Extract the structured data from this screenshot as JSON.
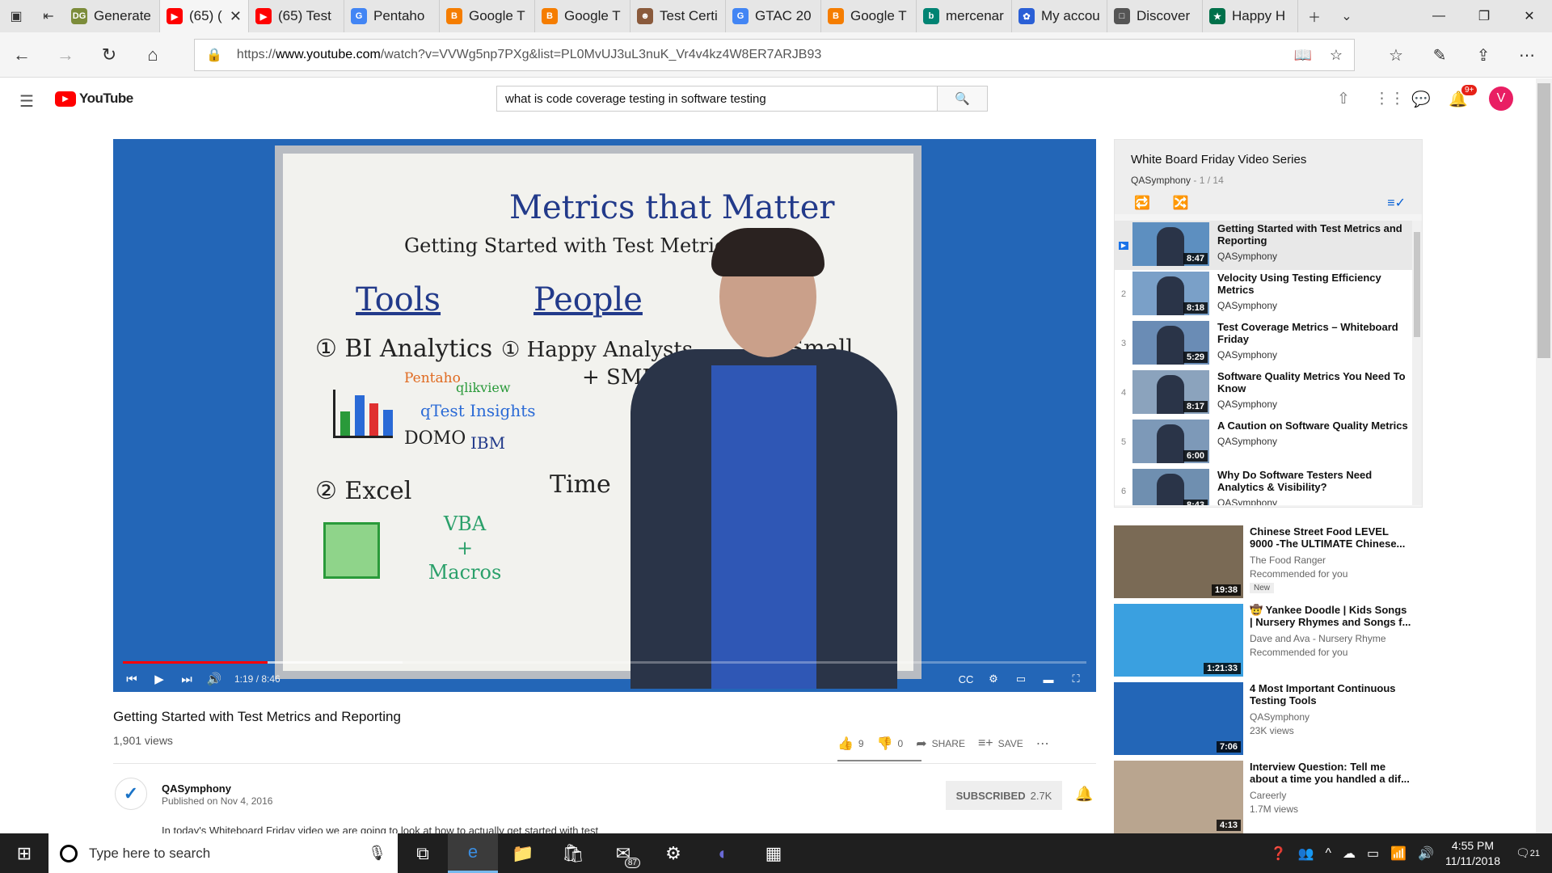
{
  "tabs": [
    {
      "label": "Generate",
      "fav": "DG",
      "color": "#7c8c3a"
    },
    {
      "label": "(65) (",
      "fav": "▶",
      "color": "#ff0000"
    },
    {
      "label": "(65) Test",
      "fav": "▶",
      "color": "#ff0000"
    },
    {
      "label": "Pentaho",
      "fav": "G",
      "color": "#4285f4"
    },
    {
      "label": "Google T",
      "fav": "B",
      "color": "#f57d00"
    },
    {
      "label": "Google T",
      "fav": "B",
      "color": "#f57d00"
    },
    {
      "label": "Test Certi",
      "fav": "☻",
      "color": "#8a5a3c"
    },
    {
      "label": "GTAC 20",
      "fav": "G",
      "color": "#4285f4"
    },
    {
      "label": "Google T",
      "fav": "B",
      "color": "#f57d00"
    },
    {
      "label": "mercenar",
      "fav": "b",
      "color": "#008373"
    },
    {
      "label": "My accou",
      "fav": "✿",
      "color": "#2a5fd6"
    },
    {
      "label": "Discover",
      "fav": "□",
      "color": "#555555"
    },
    {
      "label": "Happy H",
      "fav": "★",
      "color": "#00704a"
    }
  ],
  "address": {
    "prefix": "https://",
    "host": "www.youtube.com",
    "path": "/watch?v=VVWg5np7PXg&list=PL0MvUJ3uL3nuK_Vr4v4kz4W8ER7ARJB93"
  },
  "yt": {
    "logo": "YouTube",
    "search": "what is code coverage testing in software testing",
    "notif_count": "9+",
    "avatar": "V"
  },
  "video": {
    "board_title": "Metrics that Matter",
    "board_sub": "Getting Started with Test Metrics a",
    "board_tools": "Tools",
    "board_people": "People",
    "board_bi": "① BI Analytics",
    "board_excel": "② Excel",
    "board_happy": "① Happy Analysts",
    "board_smes": "+ SMEs",
    "board_small": "Small",
    "board_time": "Time",
    "board_vba": "VBA",
    "board_plus": "+",
    "board_macros": "Macros",
    "board_pentaho": "Pentaho",
    "board_qlik": "qlikview",
    "board_qtest": "qTest Insights",
    "board_domo": "DOMO",
    "board_ibm": "IBM",
    "time": "1:19 / 8:46",
    "progress_fraction": 0.15,
    "buffered_fraction": 0.29,
    "title": "Getting Started with Test Metrics and Reporting",
    "views": "1,901 views",
    "likes": "9",
    "dislikes": "0",
    "share": "SHARE",
    "save": "SAVE"
  },
  "channel": {
    "name": "QASymphony",
    "published": "Published on Nov 4, 2016",
    "subscribe": "SUBSCRIBED",
    "subs": "2.7K",
    "desc": "In today's Whiteboard Friday video we are going to look at how to actually get started with test"
  },
  "playlist": {
    "title": "White Board Friday Video Series",
    "channel": "QASymphony",
    "count": "1 / 14",
    "items": [
      {
        "index": "▶",
        "title": "Getting Started with Test Metrics and Reporting",
        "channel": "QASymphony",
        "duration": "8:47"
      },
      {
        "index": "2",
        "title": "Velocity Using Testing Efficiency Metrics",
        "channel": "QASymphony",
        "duration": "8:18"
      },
      {
        "index": "3",
        "title": "Test Coverage Metrics – Whiteboard Friday",
        "channel": "QASymphony",
        "duration": "5:29"
      },
      {
        "index": "4",
        "title": "Software Quality Metrics You Need To Know",
        "channel": "QASymphony",
        "duration": "8:17"
      },
      {
        "index": "5",
        "title": "A Caution on Software Quality Metrics",
        "channel": "QASymphony",
        "duration": "6:00"
      },
      {
        "index": "6",
        "title": "Why Do Software Testers Need Analytics & Visibility?",
        "channel": "QASymphony",
        "duration": "8:43"
      }
    ]
  },
  "recommended": [
    {
      "title": "Chinese Street Food LEVEL 9000 -The ULTIMATE Chinese...",
      "channel": "The Food Ranger",
      "sub": "Recommended for you",
      "badge": "New",
      "duration": "19:38",
      "color": "#7a6a55"
    },
    {
      "title": "🤠 Yankee Doodle | Kids Songs | Nursery Rhymes and Songs f...",
      "channel": "Dave and Ava - Nursery Rhyme",
      "sub": "Recommended for you",
      "badge": "",
      "duration": "1:21:33",
      "color": "#3aa0e0"
    },
    {
      "title": "4 Most Important Continuous Testing Tools",
      "channel": "QASymphony",
      "sub": "23K views",
      "badge": "",
      "duration": "7:06",
      "color": "#2366b7"
    },
    {
      "title": "Interview Question: Tell me about a time you handled a dif...",
      "channel": "Careerly",
      "sub": "1.7M views",
      "badge": "",
      "duration": "4:13",
      "color": "#b9a58f"
    }
  ],
  "taskbar": {
    "search_placeholder": "Type here to search",
    "mail_badge": "87",
    "time": "4:55 PM",
    "date": "11/11/2018",
    "notif_count": "21"
  }
}
